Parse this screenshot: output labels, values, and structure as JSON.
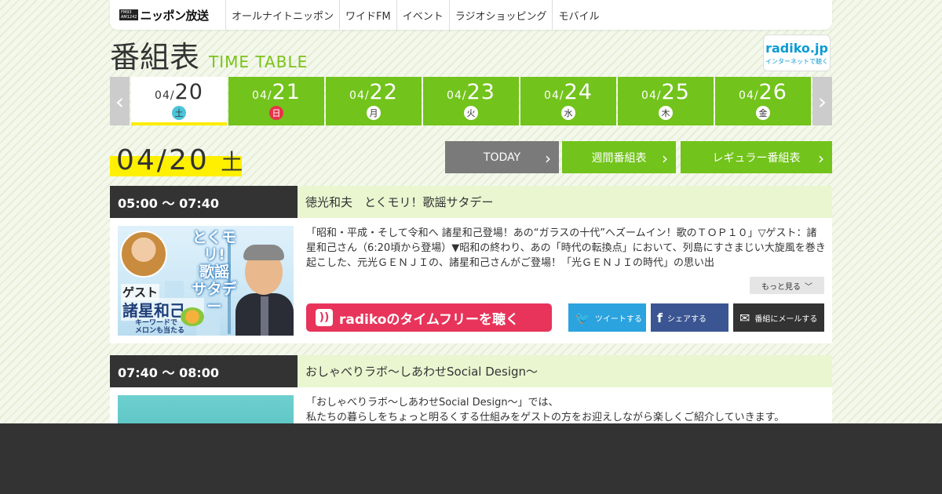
{
  "header": {
    "logo_text": "ニッポン放送",
    "logo_small_top": "FM93",
    "logo_small_bottom": "AM1242",
    "nav": [
      "オールナイトニッポン",
      "ワイドFM",
      "イベント",
      "ラジオショッピング",
      "モバイル"
    ]
  },
  "title": {
    "jp": "番組表",
    "en": "TIME TABLE"
  },
  "radiko_badge": {
    "logo": "radiko.jp",
    "sub": "インターネットで聴く"
  },
  "dates": [
    {
      "md": "04/",
      "d": "20",
      "dow": "土",
      "active": true
    },
    {
      "md": "04/",
      "d": "21",
      "dow": "日"
    },
    {
      "md": "04/",
      "d": "22",
      "dow": "月"
    },
    {
      "md": "04/",
      "d": "23",
      "dow": "火"
    },
    {
      "md": "04/",
      "d": "24",
      "dow": "水"
    },
    {
      "md": "04/",
      "d": "25",
      "dow": "木"
    },
    {
      "md": "04/",
      "d": "26",
      "dow": "金"
    }
  ],
  "arrows": {
    "prev": "‹",
    "next": "›"
  },
  "current_date": {
    "date": "04/20",
    "dow": "土"
  },
  "buttons": {
    "today": "TODAY",
    "weekly": "週間番組表",
    "regular": "レギュラー番組表",
    "chevron": "›"
  },
  "programs": [
    {
      "time": "05:00 ～ 07:40",
      "title": "徳光和夫　とくモリ！歌謡サタデー",
      "description": "「昭和・平成・そして令和へ 諸星和己登場！あの“ガラスの十代”へズームイン！歌のＴＯＰ１０」▽ゲスト：諸星和己さん（6:20頃から登場）▼昭和の終わり、あの「時代の転換点」において、列島にすさまじい大旋風を巻き起こした、元光ＧＥＮＪＩの、諸星和己さんがご登場！「光ＧＥＮＪＩの時代」の思い出",
      "more": "もっと見る",
      "radiko": "radikoのタイムフリーを聴く",
      "tweet": "ツイートする",
      "share": "シェアする",
      "mail": "番組にメールする",
      "image": {
        "title_line1": "とくモリ!",
        "title_line2": "歌謡",
        "title_line3": "サタデー",
        "guest_label": "ゲスト",
        "guest_name": "諸星和己",
        "guest_suffix": "さん",
        "note_line1": "キーワードで",
        "note_line2": "メロンも当たる"
      }
    },
    {
      "time": "07:40 ～ 08:00",
      "title": "おしゃべりラボ～しあわせSocial Design～",
      "description_line1": "「おしゃべりラボ～しあわせSocial Design～」では、",
      "description_line2": "私たちの暮らしをちょっと明るくする仕組みをゲストの方をお迎えしながら楽しくご紹介していきます。"
    }
  ],
  "colors": {
    "green": "#72c31b",
    "dark": "#333333",
    "radiko_red": "#e8345a",
    "twitter": "#2ba3df",
    "facebook": "#3b5592",
    "highlight": "#fff000"
  }
}
